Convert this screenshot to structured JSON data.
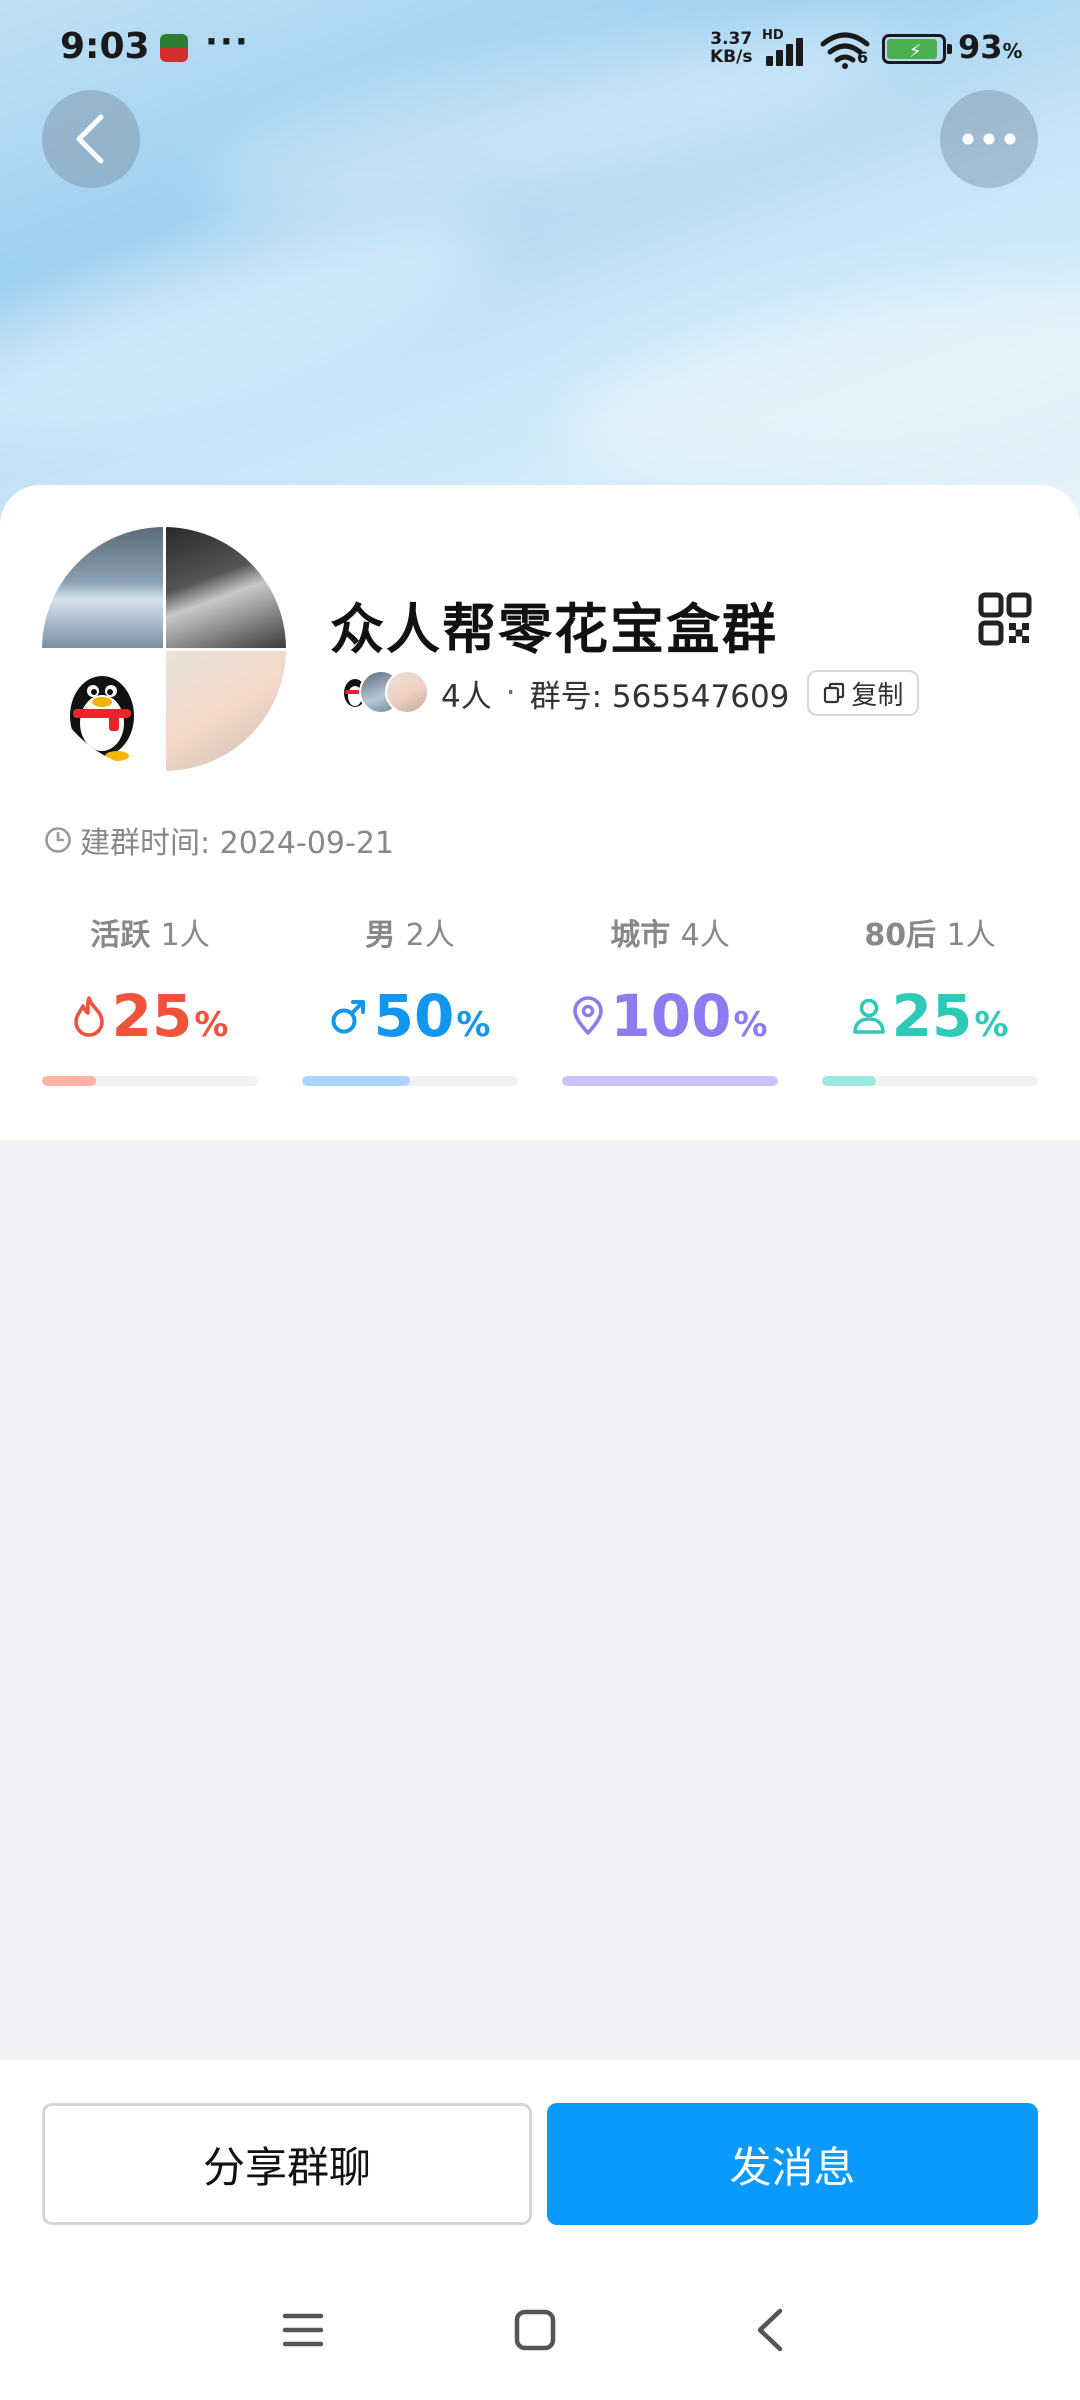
{
  "status_bar": {
    "time": "9:03",
    "more": "···",
    "net_speed_value": "3.37",
    "net_speed_unit": "KB/s",
    "hd_label": "HD",
    "wifi_badge": "6",
    "battery_percent": "93",
    "battery_unit": "%",
    "battery_level": 0.93
  },
  "header": {
    "back_icon": "chevron-left-icon",
    "more_icon": "more-horizontal-icon"
  },
  "group": {
    "name": "众人帮零花宝盒群",
    "member_count": "4人",
    "separator": "·",
    "id_label": "群号: 565547609",
    "copy_label": "复制",
    "created_label": "建群时间: 2024-09-21",
    "qr_icon": "qr-code-icon"
  },
  "stats": [
    {
      "label": "活跃",
      "count": "1人",
      "value": "25",
      "unit": "%",
      "percent": 25,
      "color": "#f0533a",
      "bar_color": "#ffb3a6",
      "icon": "flame-icon"
    },
    {
      "label": "男",
      "count": "2人",
      "value": "50",
      "unit": "%",
      "percent": 50,
      "color": "#1296f0",
      "bar_color": "#a9d4ff",
      "icon": "male-icon"
    },
    {
      "label": "城市",
      "count": "4人",
      "value": "100",
      "unit": "%",
      "percent": 100,
      "color": "#8e7bf0",
      "bar_color": "#cbc2fb",
      "icon": "location-pin-icon"
    },
    {
      "label": "80后",
      "count": "1人",
      "value": "25",
      "unit": "%",
      "percent": 25,
      "color": "#2fcab7",
      "bar_color": "#9be8de",
      "icon": "person-icon"
    }
  ],
  "actions": {
    "share_label": "分享群聊",
    "send_label": "发消息"
  },
  "nav": {
    "menu_icon": "menu-icon",
    "home_icon": "home-square-icon",
    "back_icon": "back-triangle-icon"
  }
}
